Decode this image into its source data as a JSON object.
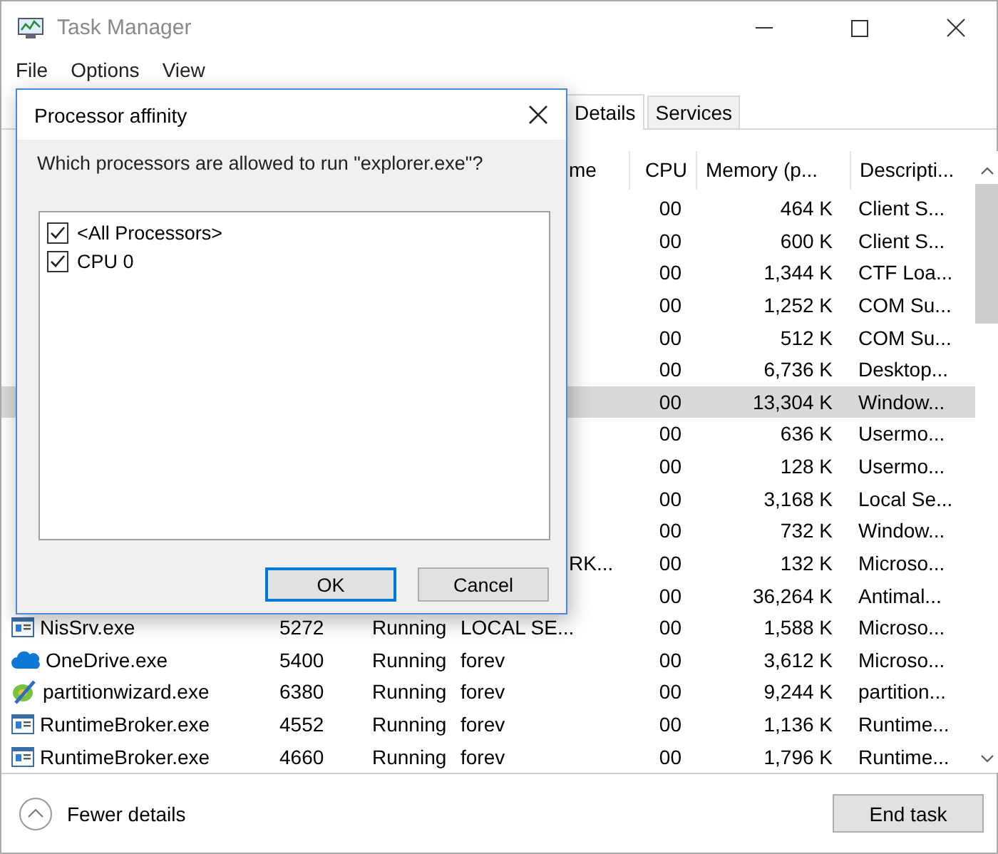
{
  "window": {
    "title": "Task Manager"
  },
  "menu": [
    "File",
    "Options",
    "View"
  ],
  "tabs": [
    {
      "label": "Details",
      "selected": true
    },
    {
      "label": "Services",
      "selected": false
    }
  ],
  "header": {
    "fragment": "me",
    "cpu": "CPU",
    "memory": "Memory (p...",
    "description": "Descripti..."
  },
  "rows": [
    {
      "kind": "covered",
      "cpu": "00",
      "memory": "464 K",
      "description": "Client S...",
      "selected": false
    },
    {
      "kind": "covered",
      "cpu": "00",
      "memory": "600 K",
      "description": "Client S...",
      "selected": false
    },
    {
      "kind": "covered",
      "cpu": "00",
      "memory": "1,344 K",
      "description": "CTF Loa...",
      "selected": false
    },
    {
      "kind": "covered",
      "cpu": "00",
      "memory": "1,252 K",
      "description": "COM Su...",
      "selected": false
    },
    {
      "kind": "covered",
      "cpu": "00",
      "memory": "512 K",
      "description": "COM Su...",
      "selected": false
    },
    {
      "kind": "covered",
      "cpu": "00",
      "memory": "6,736 K",
      "description": "Desktop...",
      "selected": false
    },
    {
      "kind": "covered",
      "cpu": "00",
      "memory": "13,304 K",
      "description": "Window...",
      "selected": true
    },
    {
      "kind": "covered",
      "cpu": "00",
      "memory": "636 K",
      "description": "Usermo...",
      "selected": false
    },
    {
      "kind": "covered",
      "cpu": "00",
      "memory": "128 K",
      "description": "Usermo...",
      "selected": false
    },
    {
      "kind": "covered",
      "cpu": "00",
      "memory": "3,168 K",
      "description": "Local Se...",
      "selected": false
    },
    {
      "kind": "covered",
      "cpu": "00",
      "memory": "732 K",
      "description": "Window...",
      "selected": false
    },
    {
      "kind": "covered",
      "fragment": "RK...",
      "cpu": "00",
      "memory": "132 K",
      "description": "Microso...",
      "selected": false
    },
    {
      "kind": "covered",
      "cpu": "00",
      "memory": "36,264 K",
      "description": "Antimal...",
      "selected": false
    },
    {
      "kind": "window",
      "name": "NisSrv.exe",
      "pid": "5272",
      "status": "Running",
      "user": "LOCAL SE...",
      "cpu": "00",
      "memory": "1,588 K",
      "description": "Microso...",
      "selected": false
    },
    {
      "kind": "cloud",
      "name": "OneDrive.exe",
      "pid": "5400",
      "status": "Running",
      "user": "forev",
      "cpu": "00",
      "memory": "3,612 K",
      "description": "Microso...",
      "selected": false
    },
    {
      "kind": "wizard",
      "name": "partitionwizard.exe",
      "pid": "6380",
      "status": "Running",
      "user": "forev",
      "cpu": "00",
      "memory": "9,244 K",
      "description": "partition...",
      "selected": false
    },
    {
      "kind": "window",
      "name": "RuntimeBroker.exe",
      "pid": "4552",
      "status": "Running",
      "user": "forev",
      "cpu": "00",
      "memory": "1,136 K",
      "description": "Runtime...",
      "selected": false
    },
    {
      "kind": "window",
      "name": "RuntimeBroker.exe",
      "pid": "4660",
      "status": "Running",
      "user": "forev",
      "cpu": "00",
      "memory": "1,796 K",
      "description": "Runtime...",
      "selected": false
    }
  ],
  "footer": {
    "toggle": "Fewer details",
    "button": "End task"
  },
  "dialog": {
    "title": "Processor affinity",
    "question": "Which processors are allowed to run \"explorer.exe\"?",
    "options": [
      {
        "label": "<All Processors>",
        "checked": true
      },
      {
        "label": "CPU 0",
        "checked": true
      }
    ],
    "buttons": [
      {
        "label": "OK",
        "default": true
      },
      {
        "label": "Cancel",
        "default": false
      }
    ]
  }
}
